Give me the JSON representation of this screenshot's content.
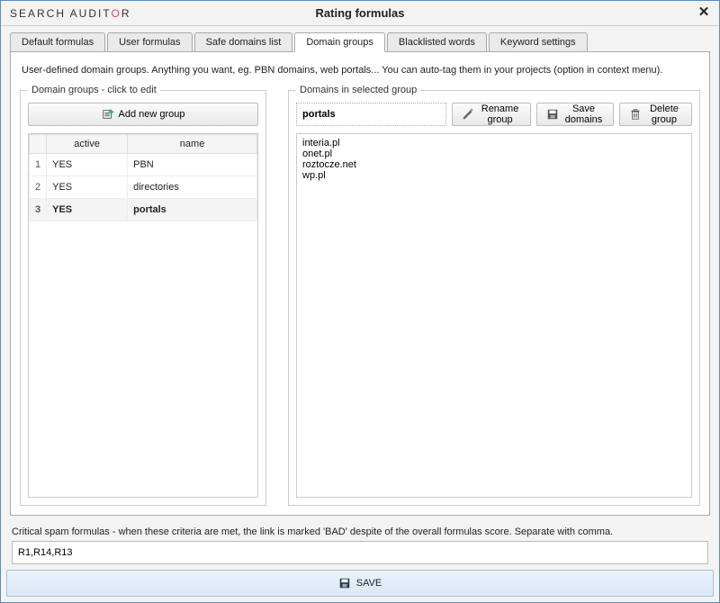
{
  "brand": {
    "head": "SEARCH AUDIT",
    "o": "O",
    "tail": "R"
  },
  "window_title": "Rating formulas",
  "close_glyph": "✕",
  "tabs": [
    "Default formulas",
    "User formulas",
    "Safe domains list",
    "Domain groups",
    "Blacklisted words",
    "Keyword settings"
  ],
  "active_tab_index": 3,
  "description": "User-defined domain groups. Anything you want, eg. PBN domains, web portals... You can auto-tag them in your projects (option in context menu).",
  "left": {
    "legend": "Domain groups - click to edit",
    "add_label": "Add new group",
    "columns": {
      "active": "active",
      "name": "name"
    },
    "rows": [
      {
        "idx": "1",
        "active": "YES",
        "name": "PBN",
        "selected": false
      },
      {
        "idx": "2",
        "active": "YES",
        "name": "directories",
        "selected": false
      },
      {
        "idx": "3",
        "active": "YES",
        "name": "portals",
        "selected": true
      }
    ]
  },
  "right": {
    "legend": "Domains in selected group",
    "group_name": "portals",
    "rename_label": "Rename group",
    "save_label": "Save domains",
    "delete_label": "Delete group",
    "domains_text": "interia.pl\nonet.pl\nroztocze.net\nwp.pl"
  },
  "critical": {
    "label": "Critical spam formulas - when these criteria are met, the link is marked 'BAD' despite of the overall formulas score. Separate with comma.",
    "value": "R1,R14,R13"
  },
  "save_button": "SAVE"
}
